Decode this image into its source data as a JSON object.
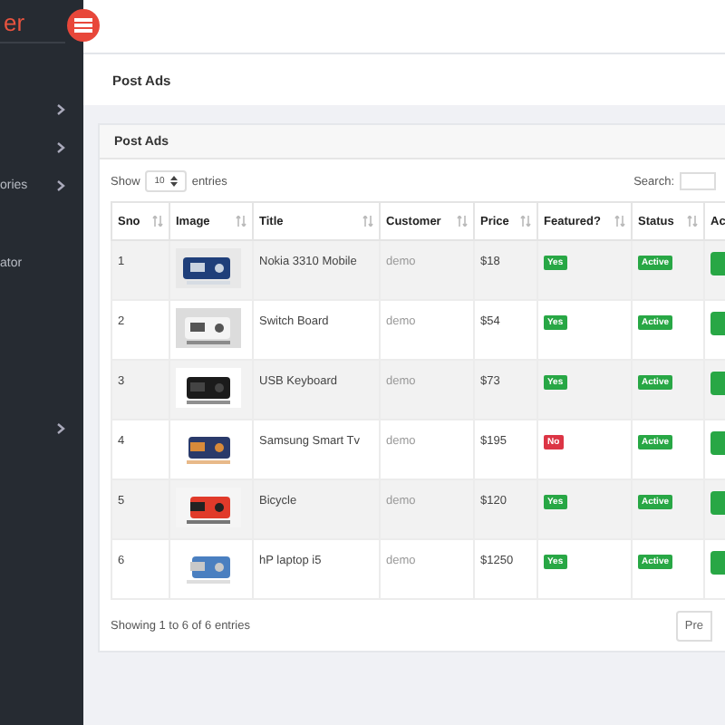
{
  "sidebar": {
    "logo": "er",
    "items": [
      {
        "expandable": true
      },
      {
        "expandable": true
      },
      {
        "label": "ories",
        "expandable": true
      },
      {
        "label": "ator",
        "expandable": false
      },
      {
        "expandable": true
      }
    ]
  },
  "page_title": "Post Ads",
  "card": {
    "title": "Post Ads",
    "show_label": "Show",
    "page_size": "10",
    "entries_label": "entries",
    "search_label": "Search:",
    "columns": [
      "Sno",
      "Image",
      "Title",
      "Customer",
      "Price",
      "Featured?",
      "Status",
      "Ac"
    ],
    "rows": [
      {
        "sno": "1",
        "title": "Nokia 3310 Mobile",
        "customer": "demo",
        "price": "$18",
        "featured": true,
        "featured_label": "Yes",
        "status": "Active"
      },
      {
        "sno": "2",
        "title": "Switch Board",
        "customer": "demo",
        "price": "$54",
        "featured": true,
        "featured_label": "Yes",
        "status": "Active"
      },
      {
        "sno": "3",
        "title": "USB Keyboard",
        "customer": "demo",
        "price": "$73",
        "featured": true,
        "featured_label": "Yes",
        "status": "Active"
      },
      {
        "sno": "4",
        "title": "Samsung Smart Tv",
        "customer": "demo",
        "price": "$195",
        "featured": false,
        "featured_label": "No",
        "status": "Active"
      },
      {
        "sno": "5",
        "title": "Bicycle",
        "customer": "demo",
        "price": "$120",
        "featured": true,
        "featured_label": "Yes",
        "status": "Active"
      },
      {
        "sno": "6",
        "title": "hP laptop i5",
        "customer": "demo",
        "price": "$1250",
        "featured": true,
        "featured_label": "Yes",
        "status": "Active"
      }
    ],
    "info": "Showing 1 to 6 of 6 entries",
    "prev": "Pre"
  }
}
